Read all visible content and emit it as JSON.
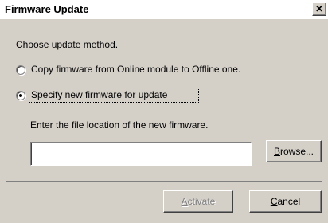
{
  "window": {
    "title": "Firmware Update",
    "close_glyph": "✕"
  },
  "dialog": {
    "prompt": "Choose update method.",
    "options": [
      {
        "label": "Copy firmware from Online module to Offline one.",
        "selected": false
      },
      {
        "label": "Specify new firmware for update",
        "selected": true
      }
    ],
    "file_instruction": "Enter the file location of the new firmware.",
    "file_input": {
      "value": "",
      "placeholder": ""
    },
    "browse_label_prefix": "",
    "browse_label_mnemonic": "B",
    "browse_label_rest": "rowse...",
    "activate_label_mnemonic": "A",
    "activate_label_rest": "ctivate",
    "activate_enabled": false,
    "cancel_label_mnemonic": "C",
    "cancel_label_rest": "ancel"
  }
}
